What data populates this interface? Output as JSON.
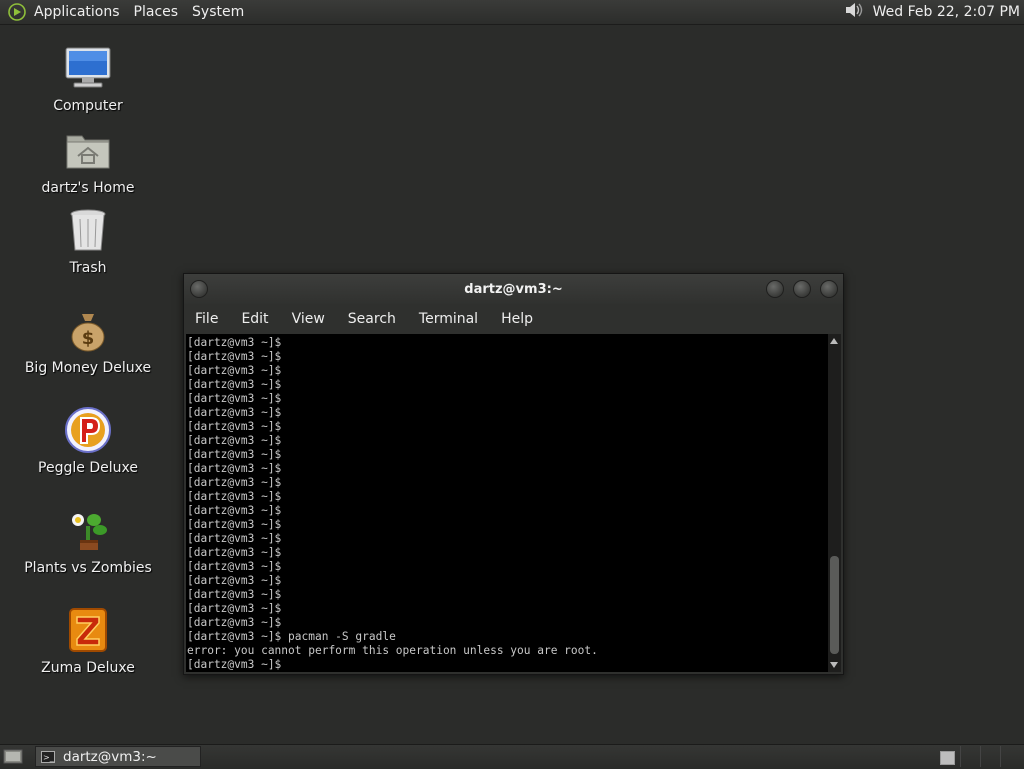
{
  "top_panel": {
    "menus": [
      "Applications",
      "Places",
      "System"
    ],
    "clock": "Wed Feb 22,  2:07 PM"
  },
  "desktop": {
    "icons": [
      {
        "label": "Computer",
        "icon": "computer-icon"
      },
      {
        "label": "dartz's Home",
        "icon": "home-folder-icon"
      },
      {
        "label": "Trash",
        "icon": "trash-icon"
      },
      {
        "label": "Big Money Deluxe",
        "icon": "money-bag-icon"
      },
      {
        "label": "Peggle Deluxe",
        "icon": "peggle-icon"
      },
      {
        "label": "Plants vs Zombies",
        "icon": "plants-icon"
      },
      {
        "label": "Zuma Deluxe",
        "icon": "zuma-icon"
      }
    ]
  },
  "terminal": {
    "title": "dartz@vm3:~",
    "menus": [
      "File",
      "Edit",
      "View",
      "Search",
      "Terminal",
      "Help"
    ],
    "lines": [
      "[dartz@vm3 ~]$",
      "[dartz@vm3 ~]$",
      "[dartz@vm3 ~]$",
      "[dartz@vm3 ~]$",
      "[dartz@vm3 ~]$",
      "[dartz@vm3 ~]$",
      "[dartz@vm3 ~]$",
      "[dartz@vm3 ~]$",
      "[dartz@vm3 ~]$",
      "[dartz@vm3 ~]$",
      "[dartz@vm3 ~]$",
      "[dartz@vm3 ~]$",
      "[dartz@vm3 ~]$",
      "[dartz@vm3 ~]$",
      "[dartz@vm3 ~]$",
      "[dartz@vm3 ~]$",
      "[dartz@vm3 ~]$",
      "[dartz@vm3 ~]$",
      "[dartz@vm3 ~]$",
      "[dartz@vm3 ~]$",
      "[dartz@vm3 ~]$",
      "[dartz@vm3 ~]$ pacman -S gradle",
      "error: you cannot perform this operation unless you are root.",
      "[dartz@vm3 ~]$"
    ]
  },
  "taskbar": {
    "task_label": "dartz@vm3:~"
  },
  "colors": {
    "desktop_bg": "#2b2c2a",
    "terminal_bg": "#000000",
    "terminal_fg": "#c8c8c8"
  }
}
